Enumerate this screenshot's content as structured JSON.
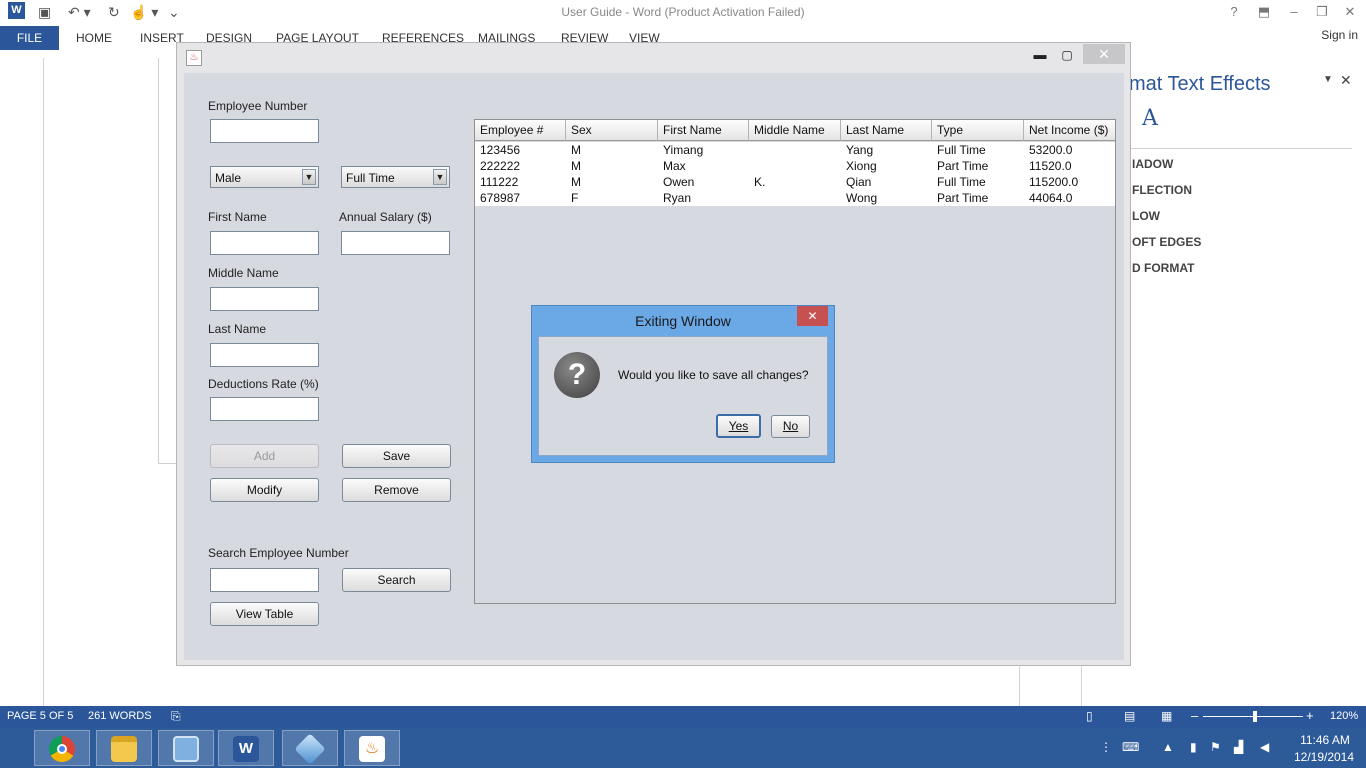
{
  "word": {
    "title": "User Guide - Word (Product Activation Failed)",
    "tabs": [
      "FILE",
      "HOME",
      "INSERT",
      "DESIGN",
      "PAGE LAYOUT",
      "REFERENCES",
      "MAILINGS",
      "REVIEW",
      "VIEW"
    ],
    "signin": "Sign in",
    "pane": {
      "title": "mat Text Effects",
      "items": [
        "IADOW",
        "FLECTION",
        "LOW",
        "OFT EDGES",
        "D FORMAT"
      ]
    },
    "status": {
      "page": "PAGE 5 OF 5",
      "words": "261 WORDS",
      "zoom": "120%"
    }
  },
  "app": {
    "labels": {
      "employee_number": "Employee Number",
      "first_name": "First Name",
      "annual_salary": "Annual Salary ($)",
      "middle_name": "Middle Name",
      "last_name": "Last Name",
      "deductions_rate": "Deductions Rate (%)",
      "search_employee_number": "Search Employee Number"
    },
    "sex_combo": "Male",
    "type_combo": "Full Time",
    "buttons": {
      "add": "Add",
      "save": "Save",
      "modify": "Modify",
      "remove": "Remove",
      "search": "Search",
      "view_table": "View Table"
    },
    "table": {
      "columns": [
        "Employee #",
        "Sex",
        "First Name",
        "Middle Name",
        "Last Name",
        "Type",
        "Net Income ($)"
      ],
      "rows": [
        [
          "123456",
          "M",
          "Yimang",
          "",
          "Yang",
          "Full Time",
          "53200.0"
        ],
        [
          "222222",
          "M",
          "Max",
          "",
          "Xiong",
          "Part Time",
          "11520.0"
        ],
        [
          "111222",
          "M",
          "Owen",
          "K.",
          "Qian",
          "Full Time",
          "115200.0"
        ],
        [
          "678987",
          "F",
          "Ryan",
          "",
          "Wong",
          "Part Time",
          "44064.0"
        ]
      ]
    }
  },
  "dialog": {
    "title": "Exiting Window",
    "message": "Would you like to save all changes?",
    "yes": "Yes",
    "no": "No"
  },
  "taskbar": {
    "apps": [
      "chrome-icon",
      "file-explorer-icon",
      "control-panel-icon",
      "word-icon",
      "virtualbox-icon",
      "java-icon"
    ],
    "time": "11:46 AM",
    "date": "12/19/2014"
  }
}
